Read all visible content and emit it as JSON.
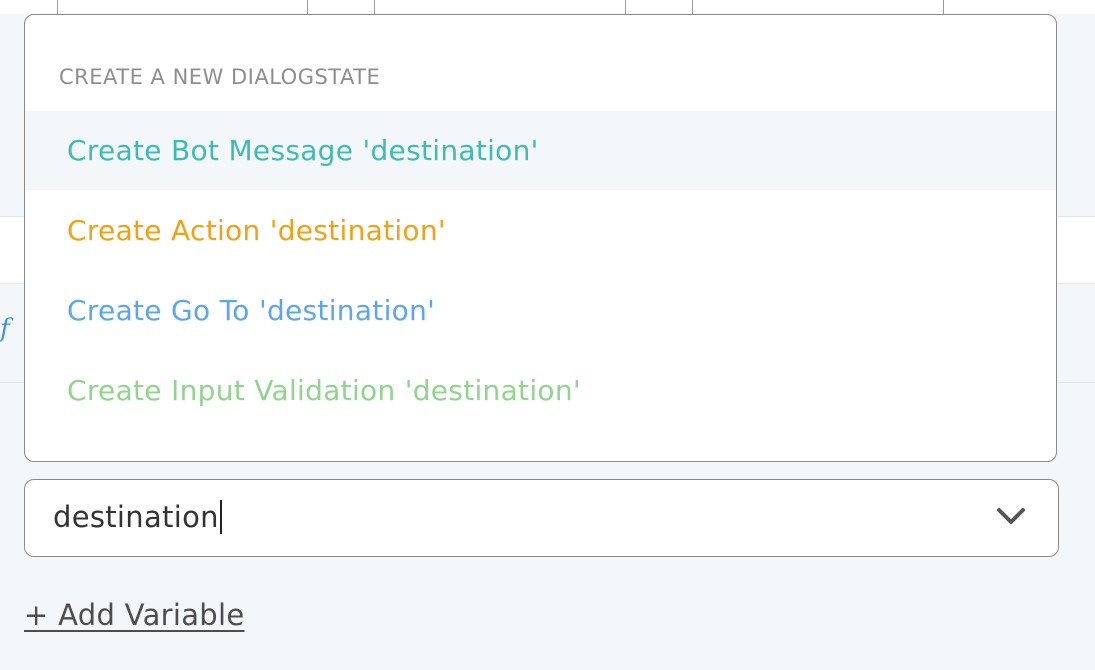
{
  "dropdown": {
    "header": "CREATE A NEW DIALOGSTATE",
    "items": [
      {
        "label": "Create Bot Message 'destination'",
        "color": "#3cbcb4"
      },
      {
        "label": "Create Action 'destination'",
        "color": "#f4a013"
      },
      {
        "label": "Create Go To 'destination'",
        "color": "#5aa6f0"
      },
      {
        "label": "Create Input Validation 'destination'",
        "color": "#8fd58c"
      }
    ]
  },
  "select": {
    "value": "destination",
    "icon": "chevron-down-icon"
  },
  "add_variable": {
    "label": "+ Add Variable"
  },
  "background": {
    "function_icon": "ƒ"
  }
}
